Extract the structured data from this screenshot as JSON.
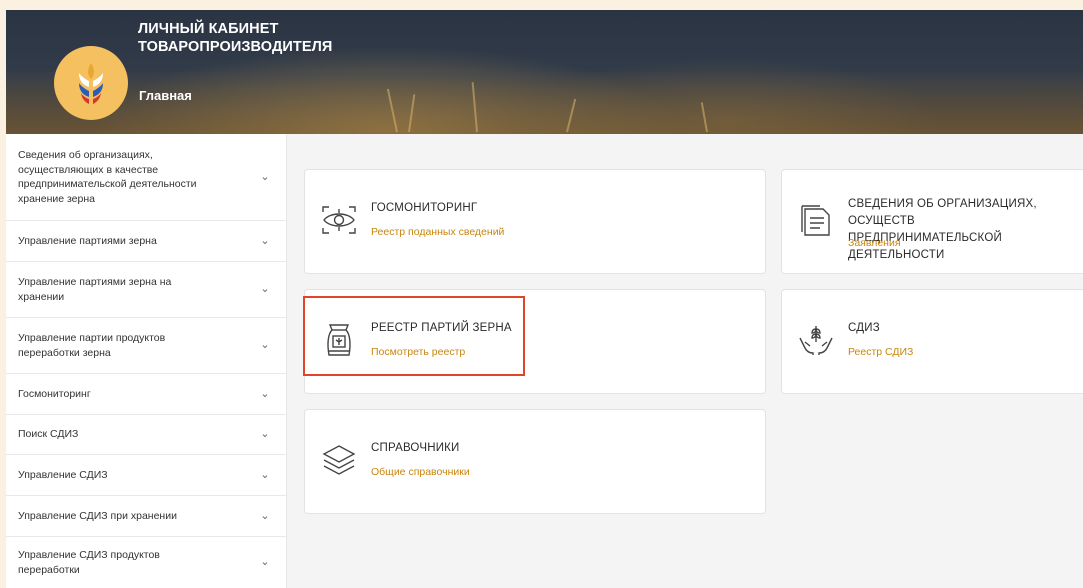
{
  "header": {
    "title_line1": "ЛИЧНЫЙ КАБИНЕТ",
    "title_line2": "ТОВАРОПРОИЗВОДИТЕЛЯ",
    "breadcrumb": "Главная"
  },
  "sidebar": {
    "items": [
      {
        "label": "Сведения об организациях, осуществляющих в качестве предпринимательской деятельности хранение зерна"
      },
      {
        "label": "Управление партиями зерна"
      },
      {
        "label": "Управление партиями зерна на хранении"
      },
      {
        "label": "Управление партии продуктов переработки зерна"
      },
      {
        "label": "Госмониторинг"
      },
      {
        "label": "Поиск СДИЗ"
      },
      {
        "label": "Управление СДИЗ"
      },
      {
        "label": "Управление СДИЗ при хранении"
      },
      {
        "label": "Управление СДИЗ продуктов переработки"
      }
    ]
  },
  "cards": {
    "gosmonitoring": {
      "title": "ГОСМОНИТОРИНГ",
      "link": "Реестр поданных сведений",
      "icon": "eye-scan-icon"
    },
    "organizations": {
      "title_line1": "СВЕДЕНИЯ ОБ ОРГАНИЗАЦИЯХ, ОСУЩЕСТВ",
      "title_line2": "ПРЕДПРИНИМАТЕЛЬСКОЙ ДЕЯТЕЛЬНОСТИ",
      "link": "Заявления",
      "icon": "document-icon"
    },
    "grain_registry": {
      "title": "РЕЕСТР ПАРТИЙ ЗЕРНА",
      "link": "Посмотреть реестр",
      "icon": "grain-bag-icon"
    },
    "sdiz": {
      "title": "СДИЗ",
      "link": "Реестр СДИЗ",
      "icon": "hands-wheat-icon"
    },
    "directories": {
      "title": "СПРАВОЧНИКИ",
      "link": "Общие справочники",
      "icon": "layers-icon"
    }
  },
  "colors": {
    "accent": "#c8860f",
    "highlight": "#e0442a",
    "logo": "#f5c060"
  }
}
